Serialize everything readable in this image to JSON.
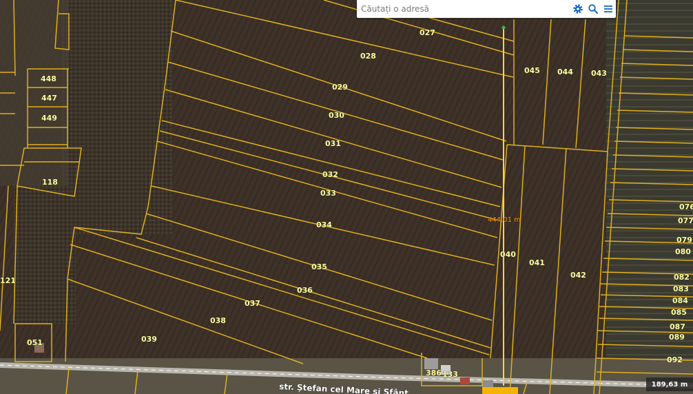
{
  "search": {
    "placeholder": "Căutați o adresă"
  },
  "toolbar": {
    "settings_icon": "gear-icon",
    "search_icon": "search-icon",
    "menu_icon": "hamburger-menu-icon"
  },
  "measurement": {
    "label": "444,01 m",
    "color": "#ffd54f"
  },
  "scale": {
    "label": "189,63 m"
  },
  "street": {
    "name": "str. Ștefan cel Mare și Sfânt"
  },
  "colors": {
    "parcel_line": "#e0b020",
    "field": "#3c3026",
    "trees": "#3a3126"
  },
  "parcels": [
    {
      "id": "p027",
      "label": "027"
    },
    {
      "id": "p028",
      "label": "028"
    },
    {
      "id": "p029",
      "label": "029"
    },
    {
      "id": "p030",
      "label": "030"
    },
    {
      "id": "p031",
      "label": "031"
    },
    {
      "id": "p032",
      "label": "032"
    },
    {
      "id": "p033",
      "label": "033"
    },
    {
      "id": "p034",
      "label": "034"
    },
    {
      "id": "p035",
      "label": "035"
    },
    {
      "id": "p036",
      "label": "036"
    },
    {
      "id": "p037",
      "label": "037"
    },
    {
      "id": "p038",
      "label": "038"
    },
    {
      "id": "p039",
      "label": "039"
    },
    {
      "id": "p040",
      "label": "040"
    },
    {
      "id": "p041",
      "label": "041"
    },
    {
      "id": "p042",
      "label": "042"
    },
    {
      "id": "p043",
      "label": "043"
    },
    {
      "id": "p044",
      "label": "044"
    },
    {
      "id": "p045",
      "label": "045"
    },
    {
      "id": "p448",
      "label": "448"
    },
    {
      "id": "p447",
      "label": "447"
    },
    {
      "id": "p449",
      "label": "449"
    },
    {
      "id": "p118",
      "label": "118"
    },
    {
      "id": "p121",
      "label": "121"
    },
    {
      "id": "p051",
      "label": "051"
    },
    {
      "id": "p386",
      "label": "386"
    },
    {
      "id": "p133",
      "label": "133"
    },
    {
      "id": "p076",
      "label": "076"
    },
    {
      "id": "p077",
      "label": "077"
    },
    {
      "id": "p079",
      "label": "079"
    },
    {
      "id": "p080",
      "label": "080"
    },
    {
      "id": "p082",
      "label": "082"
    },
    {
      "id": "p083",
      "label": "083"
    },
    {
      "id": "p084",
      "label": "084"
    },
    {
      "id": "p085",
      "label": "085"
    },
    {
      "id": "p087",
      "label": "087"
    },
    {
      "id": "p089",
      "label": "089"
    },
    {
      "id": "p092",
      "label": "092"
    }
  ]
}
